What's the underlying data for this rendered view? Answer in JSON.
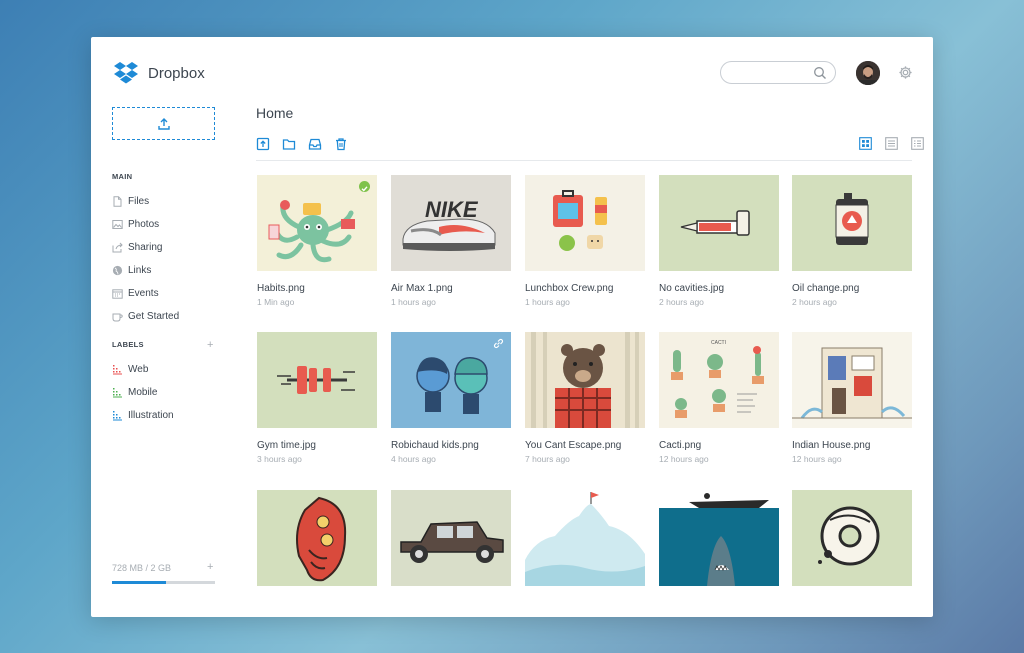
{
  "app": {
    "name": "Dropbox",
    "accent": "#1e8ad6"
  },
  "search": {
    "placeholder": "",
    "icon": "search-icon"
  },
  "sidebar": {
    "main_heading": "MAIN",
    "main_items": [
      {
        "label": "Files",
        "icon": "file-icon"
      },
      {
        "label": "Photos",
        "icon": "photo-icon"
      },
      {
        "label": "Sharing",
        "icon": "share-icon"
      },
      {
        "label": "Links",
        "icon": "globe-icon"
      },
      {
        "label": "Events",
        "icon": "calendar-icon"
      },
      {
        "label": "Get Started",
        "icon": "cup-icon"
      }
    ],
    "labels_heading": "LABELS",
    "labels_add": "+",
    "labels": [
      {
        "label": "Web",
        "color": "#e84f4f"
      },
      {
        "label": "Mobile",
        "color": "#4caf50"
      },
      {
        "label": "Illustration",
        "color": "#1e8ad6"
      }
    ],
    "storage": {
      "text": "728 MB / 2 GB",
      "add": "+",
      "used_fraction": 0.52
    }
  },
  "main": {
    "title": "Home",
    "toolbar": [
      "upload-icon",
      "folder-icon",
      "inbox-icon",
      "trash-icon"
    ],
    "views": [
      "grid-view-icon",
      "list-view-icon",
      "detail-view-icon"
    ],
    "files": [
      {
        "name": "Habits.png",
        "time": "1 Min ago",
        "bg": "#f3f0d8",
        "badge": "check"
      },
      {
        "name": "Air Max 1.png",
        "time": "1 hours ago",
        "bg": "#e0ddd6"
      },
      {
        "name": "Lunchbox Crew.png",
        "time": "1 hours ago",
        "bg": "#f4f1e6"
      },
      {
        "name": "No cavities.jpg",
        "time": "2 hours ago",
        "bg": "#d3dfbd"
      },
      {
        "name": "Oil change.png",
        "time": "2 hours ago",
        "bg": "#d3dfbd"
      },
      {
        "name": "Gym time.jpg",
        "time": "3 hours ago",
        "bg": "#d3dfbd"
      },
      {
        "name": "Robichaud kids.png",
        "time": "4 hours ago",
        "bg": "#7fb5d8",
        "badge": "link"
      },
      {
        "name": "You Cant Escape.png",
        "time": "7 hours ago",
        "bg": "#ece4cf"
      },
      {
        "name": "Cacti.png",
        "time": "12 hours ago",
        "bg": "#f5f1e4"
      },
      {
        "name": "Indian House.png",
        "time": "12 hours ago",
        "bg": "#f7f4ea"
      },
      {
        "name": "",
        "time": "",
        "bg": "#d3dfbd"
      },
      {
        "name": "",
        "time": "",
        "bg": "#d9dec9"
      },
      {
        "name": "",
        "time": "",
        "bg": "#ffffff"
      },
      {
        "name": "",
        "time": "",
        "bg": "#0f6e8c"
      },
      {
        "name": "",
        "time": "",
        "bg": "#d3dfbd"
      }
    ]
  }
}
